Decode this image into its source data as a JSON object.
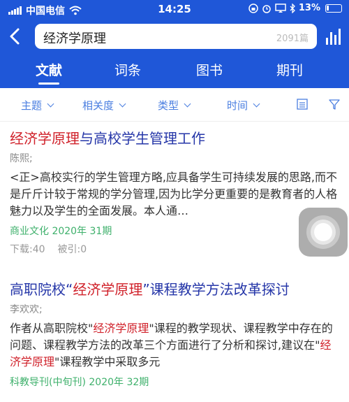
{
  "status_bar": {
    "carrier": "中国电信",
    "time": "14:25",
    "battery": "13%"
  },
  "search": {
    "query": "经济学原理",
    "count": "2091篇"
  },
  "tabs": [
    {
      "label": "文献",
      "active": true
    },
    {
      "label": "词条",
      "active": false
    },
    {
      "label": "图书",
      "active": false
    },
    {
      "label": "期刊",
      "active": false
    }
  ],
  "filters": [
    {
      "label": "主题"
    },
    {
      "label": "相关度"
    },
    {
      "label": "类型"
    },
    {
      "label": "时间"
    }
  ],
  "results": [
    {
      "title_hl": "经济学原理",
      "title_rest": "与高校学生管理工作",
      "authors": "陈熙;",
      "abstract": "<正>高校实行的学生管理方略,应具备学生可持续发展的思路,而不是斤斤计较于常规的学分管理,因为比学分更重要的是教育者的人格魅力以及学生的全面发展。本人通…",
      "source": "商业文化 2020年 31期",
      "downloads": "下载:40",
      "citations": "被引:0"
    },
    {
      "title_pre": "高职院校“",
      "title_hl": "经济学原理",
      "title_post": "”课程教学方法改革探讨",
      "authors": "李欢欢;",
      "abstract_1": "作者从高职院校\"",
      "abstract_hl_1": "经济学原理",
      "abstract_2": "\"课程的教学现状、课程教学中存在的问题、课程教学方法的改革三个方面进行了分析和探讨,建议在\"",
      "abstract_hl_2": "经济学原理",
      "abstract_3": "\"课程教学中采取多元",
      "source": "科教导刊(中旬刊) 2020年 32期"
    }
  ],
  "colors": {
    "header_bg": "#1f57d8",
    "title": "#2536a8",
    "highlight": "#d0212a",
    "source": "#3eb06b",
    "filter": "#4a7ee0"
  }
}
